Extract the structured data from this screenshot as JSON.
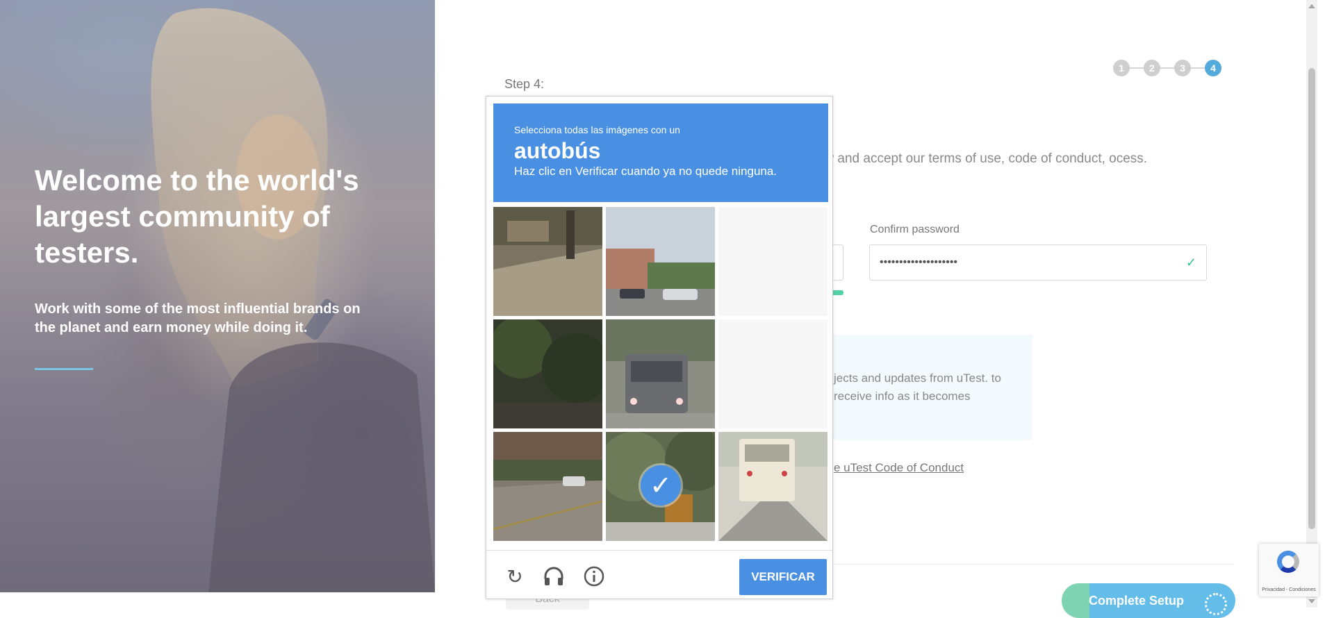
{
  "hero": {
    "title": "Welcome to the world's largest community of testers.",
    "subtitle": "Work with some of the most influential brands on the planet and earn money while doing it."
  },
  "stepper": {
    "steps": [
      "1",
      "2",
      "3",
      "4"
    ],
    "active": "4"
  },
  "form": {
    "step_label": "Step 4:",
    "intro_text": "unt. Then review and accept our terms of use, code of conduct, ocess.",
    "confirm_password_label": "Confirm password",
    "confirm_password_value": "••••••••••••••••••••",
    "info_text": "jects and updates from uTest. to receive info as it becomes",
    "code_of_conduct_link": "e uTest Code of Conduct",
    "back_label": "Back",
    "complete_label": "Complete Setup"
  },
  "captcha": {
    "instruction_line1": "Selecciona todas las imágenes con un",
    "keyword": "autobús",
    "instruction_line2": "Haz clic en Verificar cuando ya no quede ninguna.",
    "verify_label": "VERIFICAR",
    "tiles": [
      {
        "scene": "sidewalk-street",
        "state": "normal"
      },
      {
        "scene": "street-cars",
        "state": "normal"
      },
      {
        "scene": "blank",
        "state": "loading"
      },
      {
        "scene": "dark-trees",
        "state": "normal"
      },
      {
        "scene": "bus-front",
        "state": "normal"
      },
      {
        "scene": "blank",
        "state": "loading"
      },
      {
        "scene": "road-trees",
        "state": "normal"
      },
      {
        "scene": "school-bus-trees",
        "state": "selected"
      },
      {
        "scene": "school-bus-rear",
        "state": "normal"
      }
    ],
    "icons": [
      "reload-icon",
      "headphones-icon",
      "info-icon"
    ],
    "badge_text": "Privacidad - Condiciones"
  },
  "colors": {
    "captcha_blue": "#4a90e2",
    "step_active": "#54a9dd",
    "strength_green": "#52d1a6"
  }
}
